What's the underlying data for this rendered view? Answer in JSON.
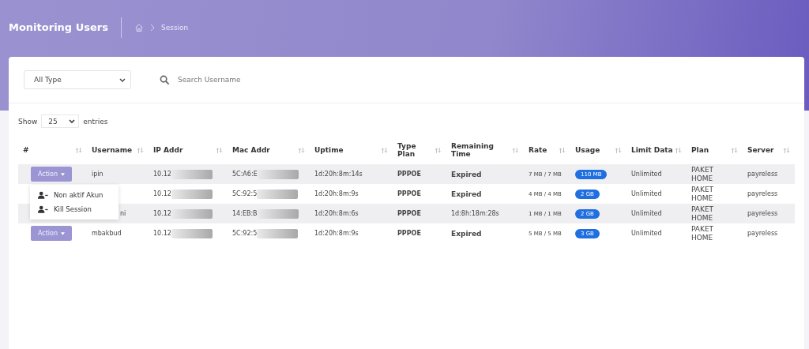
{
  "header": {
    "title": "Monitoring Users",
    "breadcrumb": "Session"
  },
  "filter": {
    "type_select": "All Type",
    "search_placeholder": "Search Username"
  },
  "entries": {
    "show": "Show",
    "value": "25",
    "suffix": "entries"
  },
  "table": {
    "columns": [
      "#",
      "Username",
      "IP Addr",
      "Mac Addr",
      "Uptime",
      "Type Plan",
      "Remaining Time",
      "Rate",
      "Usage",
      "Limit Data",
      "Plan",
      "Server"
    ],
    "rows": [
      {
        "action": "Action",
        "username": "ipin",
        "ip": "10.12",
        "mac": "5C:A6:E",
        "uptime": "1d:20h:8m:14s",
        "type": "PPPOE",
        "remaining": "Expired",
        "expired": true,
        "rate": "7 MB / 7 MB",
        "usage": "110 MB",
        "limit": "Unlimited",
        "plan": "PAKET HOME",
        "server": "payreless"
      },
      {
        "ip": "10.12",
        "mac": "5C:92:5",
        "uptime": "1d:20h:8m:9s",
        "type": "PPPOE",
        "remaining": "Expired",
        "expired": true,
        "rate": "4 MB / 4 MB",
        "usage": "2 GB",
        "limit": "Unlimited",
        "plan": "PAKET HOME",
        "server": "payreless"
      },
      {
        "username": "ni",
        "ip": "10.12",
        "mac": "14:EB:B",
        "uptime": "1d:20h:8m:6s",
        "type": "PPPOE",
        "remaining": "1d:8h:18m:28s",
        "expired": false,
        "rate": "1 MB / 1 MB",
        "usage": "2 GB",
        "limit": "Unlimited",
        "plan": "PAKET HOME",
        "server": "payreless"
      },
      {
        "action": "Action",
        "username": "mbakbud",
        "ip": "10.12",
        "mac": "5C:92:5",
        "uptime": "1d:20h:8m:9s",
        "type": "PPPOE",
        "remaining": "Expired",
        "expired": true,
        "rate": "5 MB / 5 MB",
        "usage": "3 GB",
        "limit": "Unlimited",
        "plan": "PAKET HOME",
        "server": "payreless"
      }
    ]
  },
  "action_menu": {
    "items": [
      "Non aktif Akun",
      "Kill Session"
    ]
  }
}
